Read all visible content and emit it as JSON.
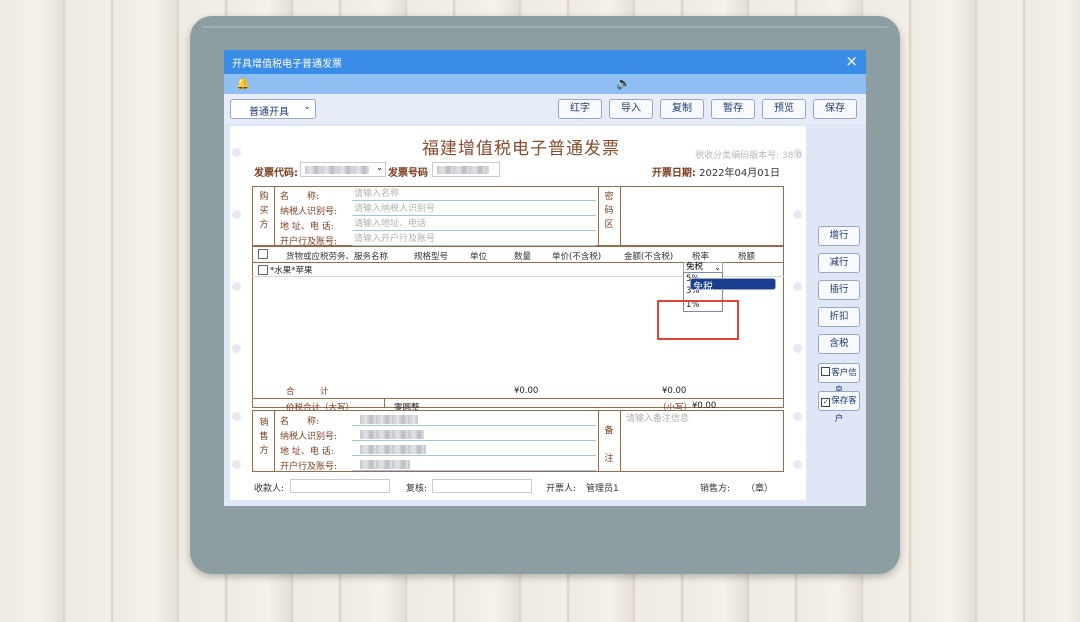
{
  "window": {
    "title": "开具增值税电子普通发票",
    "close": "×"
  },
  "subbar": {
    "bell": "🔔",
    "speaker": "🔈"
  },
  "toolbar": {
    "invoice_kind": "普通开具",
    "buttons": [
      "红字",
      "导入",
      "复制",
      "暂存",
      "预览",
      "保存"
    ]
  },
  "invoice": {
    "title": "福建增值税电子普通发票",
    "version_text": "税收分类编码版本号: 38.0",
    "code_label": "发票代码:",
    "number_label": "发票号码",
    "date_label": "开票日期:",
    "date_value": "2022年04月01日"
  },
  "buyer": {
    "section": "购买方",
    "fields": [
      {
        "label": "名　　称:",
        "placeholder": "请输入名称"
      },
      {
        "label": "纳税人识别号:",
        "placeholder": "请输入纳税人识别号"
      },
      {
        "label": "地 址、电 话:",
        "placeholder": "请输入地址、电话"
      },
      {
        "label": "开户行及账号:",
        "placeholder": "请输入开户行及账号"
      }
    ],
    "cipher_section": "密码区"
  },
  "items_table": {
    "headers": [
      "货物或应税劳务、服务名称",
      "规格型号",
      "单位",
      "数量",
      "单价(不含税)",
      "金额(不含税)",
      "税率",
      "税额"
    ],
    "rows": [
      {
        "name": "*水果*苹果",
        "tax_rate": "免税"
      }
    ],
    "tax_rate_dropdown": {
      "selected": "免税",
      "options": [
        "5%",
        "3%",
        "1%",
        "免税"
      ]
    },
    "total_label": "合　　　计",
    "total_amount": "¥0.00",
    "total_tax": "¥0.00",
    "grand_total_label": "价税合计（大写）",
    "grand_total_upper": "零圆整",
    "grand_total_lower_label": "（小写）",
    "grand_total_lower": "¥0.00"
  },
  "seller": {
    "section": "销售方",
    "fields": [
      {
        "label": "名　　称:"
      },
      {
        "label": "纳税人识别号:"
      },
      {
        "label": "地 址、电 话:"
      },
      {
        "label": "开户行及账号:"
      }
    ],
    "remarks_section": "备注",
    "remarks_placeholder": "请输入备注信息"
  },
  "footer": {
    "payee_label": "收款人:",
    "reviewer_label": "复核:",
    "issuer_label": "开票人:",
    "issuer_value": "管理员1",
    "seller_label": "销售方:",
    "seal_text": "（章）"
  },
  "side_buttons": {
    "add_row": "增行",
    "remove_row": "减行",
    "insert_row": "插行",
    "discount": "折扣",
    "tax_included": "含税",
    "customer_info": "客户信息",
    "save_customer": "保存客户",
    "save_customer_checked": true
  },
  "colors": {
    "title_bar": "#3a8de6",
    "accent_brown": "#9b6a48",
    "highlight": "#e0443a",
    "selected_option": "#1a3d8f"
  }
}
